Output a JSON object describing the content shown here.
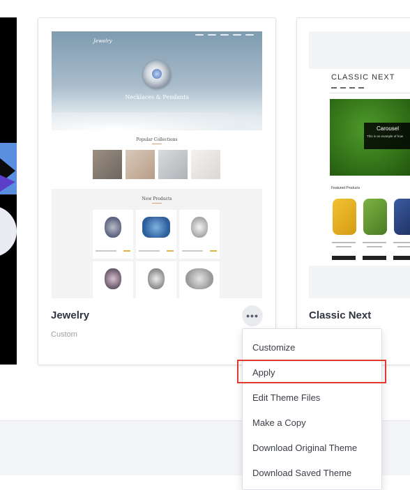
{
  "themes": [
    {
      "name": "Jewelry",
      "subtitle": "Custom",
      "preview": {
        "brand": "Jewelry",
        "headline": "Necklaces & Pendants",
        "section_1": "Popular Collections",
        "section_2": "New Products"
      }
    },
    {
      "name": "Classic Next",
      "preview": {
        "site_title": "CLASSIC NEXT",
        "banner_title": "Carousel",
        "banner_text": "This is an example of how",
        "featured_title": "Featured Products"
      }
    }
  ],
  "more_button_label": "•••",
  "dropdown": {
    "items": [
      "Customize",
      "Apply",
      "Edit Theme Files",
      "Make a Copy",
      "Download Original Theme",
      "Download Saved Theme"
    ],
    "highlighted_item": "Apply",
    "highlight_color": "#e23b2e"
  },
  "colors": {
    "card_title": "#313440",
    "muted_text": "#9a9ea8",
    "page_bottom": "#f4f5f8"
  }
}
